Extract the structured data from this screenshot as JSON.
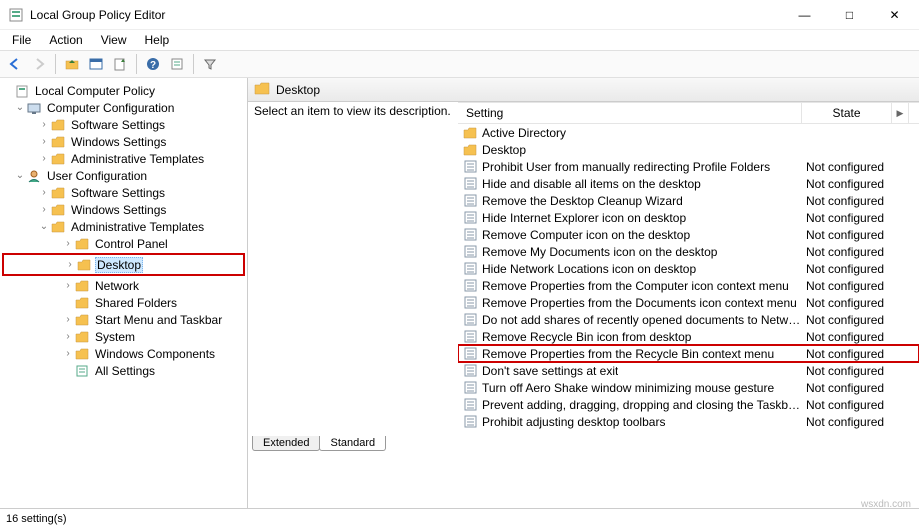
{
  "window": {
    "title": "Local Group Policy Editor",
    "minimize": "—",
    "maximize": "□",
    "close": "✕"
  },
  "menubar": [
    "File",
    "Action",
    "View",
    "Help"
  ],
  "toolbar_icons": [
    "back-icon",
    "fwd-icon",
    "up-icon",
    "show-icon",
    "export-icon",
    "refresh-icon",
    "help-icon",
    "prop-icon",
    "filter-icon"
  ],
  "tree": {
    "root": "Local Computer Policy",
    "cc": "Computer Configuration",
    "cc_items": [
      "Software Settings",
      "Windows Settings",
      "Administrative Templates"
    ],
    "uc": "User Configuration",
    "uc_items": [
      "Software Settings",
      "Windows Settings"
    ],
    "at": "Administrative Templates",
    "at_items": [
      "Control Panel",
      "Desktop",
      "Network",
      "Shared Folders",
      "Start Menu and Taskbar",
      "System",
      "Windows Components",
      "All Settings"
    ]
  },
  "crumb": "Desktop",
  "desc": "Select an item to view its description.",
  "columns": {
    "setting": "Setting",
    "state": "State"
  },
  "rows": [
    {
      "type": "folder",
      "name": "Active Directory",
      "state": ""
    },
    {
      "type": "folder",
      "name": "Desktop",
      "state": ""
    },
    {
      "type": "setting",
      "name": "Prohibit User from manually redirecting Profile Folders",
      "state": "Not configured"
    },
    {
      "type": "setting",
      "name": "Hide and disable all items on the desktop",
      "state": "Not configured"
    },
    {
      "type": "setting",
      "name": "Remove the Desktop Cleanup Wizard",
      "state": "Not configured"
    },
    {
      "type": "setting",
      "name": "Hide Internet Explorer icon on desktop",
      "state": "Not configured"
    },
    {
      "type": "setting",
      "name": "Remove Computer icon on the desktop",
      "state": "Not configured"
    },
    {
      "type": "setting",
      "name": "Remove My Documents icon on the desktop",
      "state": "Not configured"
    },
    {
      "type": "setting",
      "name": "Hide Network Locations icon on desktop",
      "state": "Not configured"
    },
    {
      "type": "setting",
      "name": "Remove Properties from the Computer icon context menu",
      "state": "Not configured"
    },
    {
      "type": "setting",
      "name": "Remove Properties from the Documents icon context menu",
      "state": "Not configured"
    },
    {
      "type": "setting",
      "name": "Do not add shares of recently opened documents to Networ...",
      "state": "Not configured"
    },
    {
      "type": "setting",
      "name": "Remove Recycle Bin icon from desktop",
      "state": "Not configured"
    },
    {
      "type": "setting",
      "name": "Remove Properties from the Recycle Bin context menu",
      "state": "Not configured",
      "hl": true
    },
    {
      "type": "setting",
      "name": "Don't save settings at exit",
      "state": "Not configured"
    },
    {
      "type": "setting",
      "name": "Turn off Aero Shake window minimizing mouse gesture",
      "state": "Not configured"
    },
    {
      "type": "setting",
      "name": "Prevent adding, dragging, dropping and closing the Taskbar...",
      "state": "Not configured"
    },
    {
      "type": "setting",
      "name": "Prohibit adjusting desktop toolbars",
      "state": "Not configured"
    }
  ],
  "tabs": {
    "extended": "Extended",
    "standard": "Standard"
  },
  "status": "16 setting(s)",
  "watermark": "wsxdn.com"
}
